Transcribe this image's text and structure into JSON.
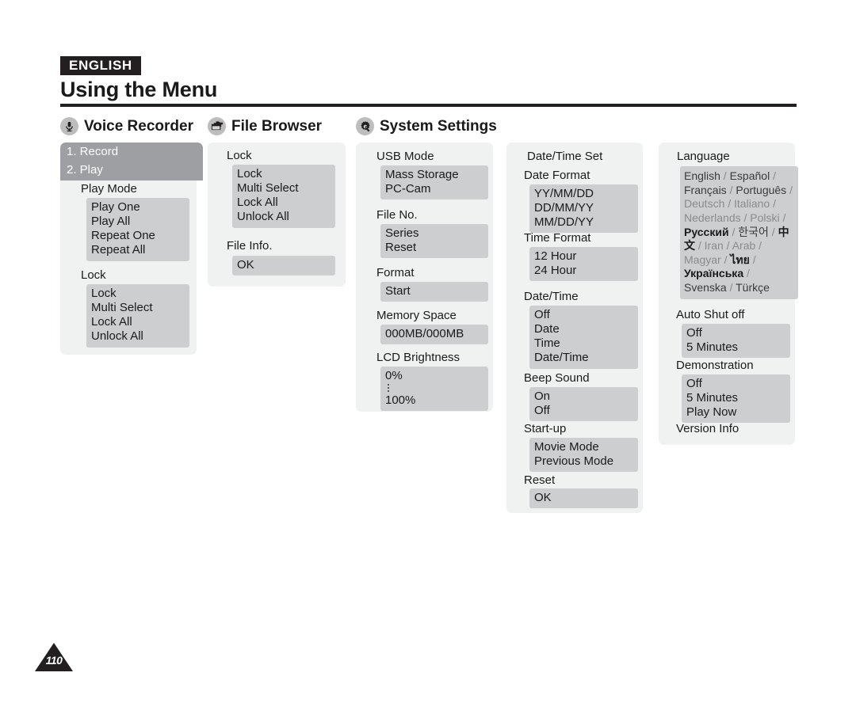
{
  "header": {
    "language_badge": "ENGLISH",
    "title": "Using the Menu"
  },
  "sections": [
    {
      "id": "voice-recorder",
      "icon": "microphone-icon",
      "label": "Voice Recorder"
    },
    {
      "id": "file-browser",
      "icon": "folder-stack-icon",
      "label": "File Browser"
    },
    {
      "id": "system-settings",
      "icon": "gear-wrench-icon",
      "label": "System Settings"
    }
  ],
  "voice_recorder": {
    "menu_items": [
      {
        "label": "1. Record"
      },
      {
        "label": "2. Play"
      }
    ],
    "groups": [
      {
        "label": "Play Mode",
        "options": [
          "Play One",
          "Play All",
          "Repeat One",
          "Repeat All"
        ]
      },
      {
        "label": "Lock",
        "options": [
          "Lock",
          "Multi Select",
          "Lock All",
          "Unlock All"
        ]
      }
    ]
  },
  "file_browser": {
    "groups": [
      {
        "label": "Lock",
        "options": [
          "Lock",
          "Multi Select",
          "Lock All",
          "Unlock All"
        ]
      },
      {
        "label": "File Info.",
        "options": [
          "OK"
        ]
      }
    ]
  },
  "system_settings": {
    "usb_column": {
      "usb_mode": {
        "label": "USB Mode",
        "options": [
          "Mass Storage",
          "PC-Cam"
        ]
      },
      "file_no": {
        "label": "File No.",
        "options": [
          "Series",
          "Reset"
        ]
      },
      "format": {
        "label": "Format",
        "options": [
          "Start"
        ]
      },
      "memory_space": {
        "label": "Memory Space",
        "options": [
          "000MB/000MB"
        ]
      },
      "lcd_brightness": {
        "label": "LCD Brightness",
        "min": "0%",
        "max": "100%"
      }
    },
    "datetime_column": {
      "title": "Date/Time Set",
      "date_format": {
        "label": "Date Format",
        "options": [
          "YY/MM/DD",
          "DD/MM/YY",
          "MM/DD/YY"
        ]
      },
      "time_format": {
        "label": "Time Format",
        "options": [
          "12 Hour",
          "24 Hour"
        ]
      },
      "date_time": {
        "label": "Date/Time",
        "options": [
          "Off",
          "Date",
          "Time",
          "Date/Time"
        ]
      },
      "beep_sound": {
        "label": "Beep Sound",
        "options": [
          "On",
          "Off"
        ]
      },
      "start_up": {
        "label": "Start-up",
        "options": [
          "Movie Mode",
          "Previous Mode"
        ]
      },
      "reset": {
        "label": "Reset",
        "options": [
          "OK"
        ]
      }
    },
    "language_column": {
      "language": {
        "label": "Language",
        "values": [
          "English",
          "Español",
          "Français",
          "Português",
          "Deutsch",
          "Italiano",
          "Nederlands",
          "Polski",
          "Русский",
          "한국어",
          "中文",
          "Iran",
          "Arab",
          "Magyar",
          "ไทย",
          "Українська",
          "Svenska",
          "Türkçe"
        ]
      },
      "auto_shut_off": {
        "label": "Auto Shut off",
        "options": [
          "Off",
          "5 Minutes"
        ]
      },
      "demonstration": {
        "label": "Demonstration",
        "options": [
          "Off",
          "5 Minutes",
          "Play Now"
        ]
      },
      "version_info": {
        "label": "Version Info"
      }
    }
  },
  "footer": {
    "page_number": "110"
  }
}
